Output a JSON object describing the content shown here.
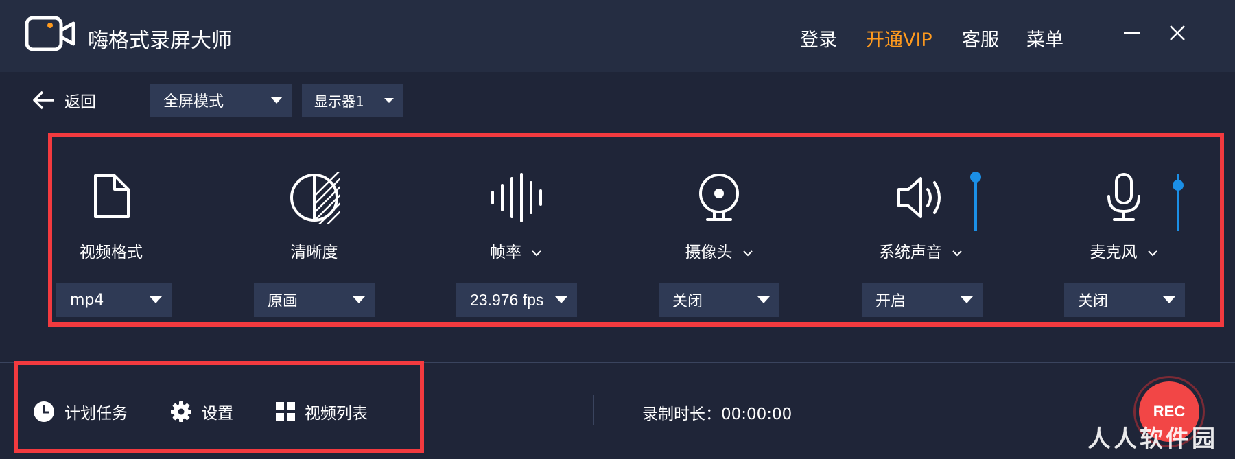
{
  "app": {
    "title": "嗨格式录屏大师",
    "logo_icon": "video-camera-logo-icon",
    "accent_color": "#ff9a1e"
  },
  "header": {
    "login": "登录",
    "vip": "开通VIP",
    "service": "客服",
    "menu": "菜单",
    "minimize_icon": "minimize-icon",
    "close_icon": "close-icon"
  },
  "toolbar": {
    "back_label": "返回",
    "mode": "全屏模式",
    "display": "显示器1"
  },
  "settings": [
    {
      "label": "视频格式",
      "value": "mp4",
      "icon": "file-icon"
    },
    {
      "label": "清晰度",
      "value": "原画",
      "icon": "clarity-icon"
    },
    {
      "label": "帧率",
      "value": "23.976 fps",
      "icon": "waveform-icon"
    },
    {
      "label": "摄像头",
      "value": "关闭",
      "icon": "webcam-icon"
    },
    {
      "label": "系统声音",
      "value": "开启",
      "icon": "speaker-icon",
      "volume_level": 1.0
    },
    {
      "label": "麦克风",
      "value": "关闭",
      "icon": "microphone-icon",
      "volume_level": 0.8
    }
  ],
  "bottom": {
    "schedule": "计划任务",
    "settings": "设置",
    "video_list": "视频列表",
    "duration_label": "录制时长：",
    "duration_value": "00:00:00",
    "rec_label": "REC"
  },
  "watermark": "人人软件园",
  "colors": {
    "background": "#1f2538",
    "titlebar": "#252d42",
    "select": "#2f3a55",
    "highlight": "#f23a3f",
    "slider": "#1b8fe6",
    "rec": "#f24646"
  }
}
